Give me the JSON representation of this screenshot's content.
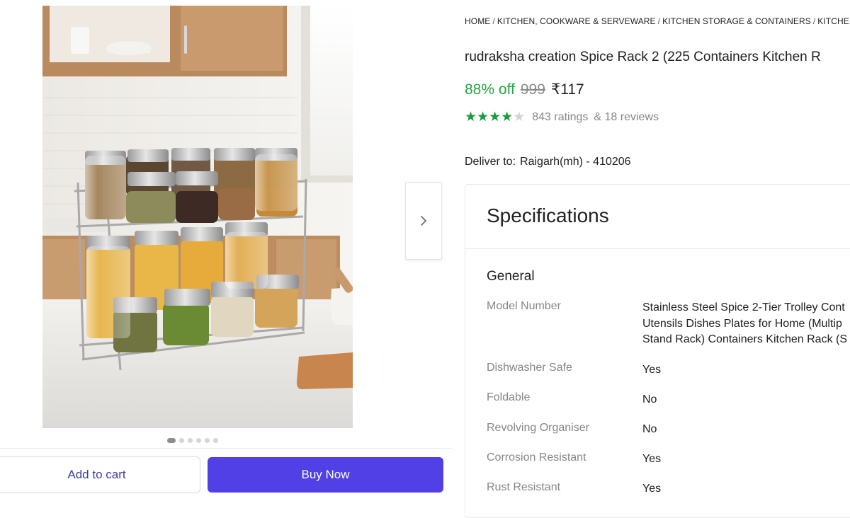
{
  "gallery": {
    "next_icon": "chevron-right-icon",
    "dots_total": 6,
    "active_dot_index": 0
  },
  "actions": {
    "add_to_cart": "Add to cart",
    "buy_now": "Buy Now"
  },
  "breadcrumb": [
    "HOME",
    "KITCHEN, COOKWARE & SERVEWARE",
    "KITCHEN STORAGE & CONTAINERS",
    "KITCHE"
  ],
  "product": {
    "title": "rudraksha creation Spice Rack 2 (225 Containers Kitchen R",
    "discount": "88% off",
    "mrp": "999",
    "price": "₹117",
    "rating_stars": 4,
    "ratings": "843 ratings",
    "reviews": "& 18 reviews"
  },
  "delivery": {
    "label": "Deliver to:",
    "location": "Raigarh(mh) - 410206"
  },
  "specifications": {
    "heading": "Specifications",
    "section": "General",
    "rows": [
      {
        "label": "Model Number",
        "value_lines": [
          "Stainless Steel Spice 2-Tier Trolley Cont",
          "Utensils Dishes Plates for Home (Multip",
          "Stand Rack) Containers Kitchen Rack (S"
        ]
      },
      {
        "label": "Dishwasher Safe",
        "value": "Yes"
      },
      {
        "label": "Foldable",
        "value": "No"
      },
      {
        "label": "Revolving Organiser",
        "value": "No"
      },
      {
        "label": "Corrosion Resistant",
        "value": "Yes"
      },
      {
        "label": "Rust Resistant",
        "value": "Yes"
      }
    ]
  },
  "colors": {
    "buy_button": "#5040e6",
    "discount_green": "#26a541",
    "star_green": "#1e9a3c"
  }
}
